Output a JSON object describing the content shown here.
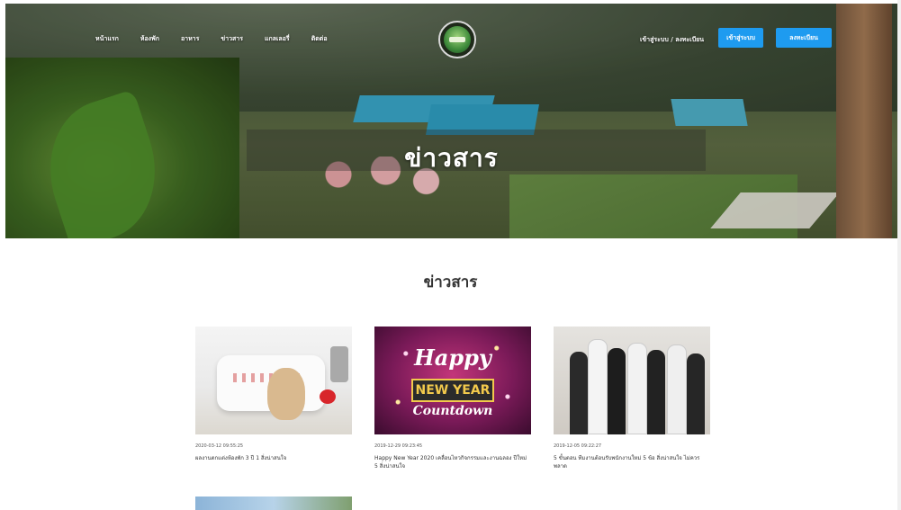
{
  "nav": {
    "items": [
      "หน้าแรก",
      "ห้องพัก",
      "อาหาร",
      "ข่าวสาร",
      "แกลเลอรี่",
      "ติดต่อ"
    ],
    "right_link": "เข้าสู่ระบบ / ลงทะเบียน",
    "login_label": "เข้าสู่ระบบ",
    "register_label": "ลงทะเบียน"
  },
  "hero": {
    "title": "ข่าวสาร"
  },
  "section": {
    "title": "ข่าวสาร"
  },
  "cards": [
    {
      "date": "2020-03-12 09:55:25",
      "title": "ผลงานตกแต่งห้องพัก 3 ปี 1 สิ่งน่าสนใจ",
      "image": "bedroom-pillow-teddy"
    },
    {
      "date": "2019-12-29 09:23:45",
      "title": "Happy New Year 2020 เคลื่อนไหวกิจกรรมและงานฉลอง ปีใหม่ 5 สิ่งน่าสนใจ",
      "image": "happy-new-year-countdown"
    },
    {
      "date": "2019-12-05 09:22:27",
      "title": "5 ขั้นตอน ทีมงานต้อนรับพนักงานใหม่ 5 ข้อ สิ่งน่าสนใจ ไม่ควรพลาด",
      "image": "business-team"
    }
  ],
  "colors": {
    "primary_button": "#1e9bf0",
    "heading": "#333333"
  }
}
